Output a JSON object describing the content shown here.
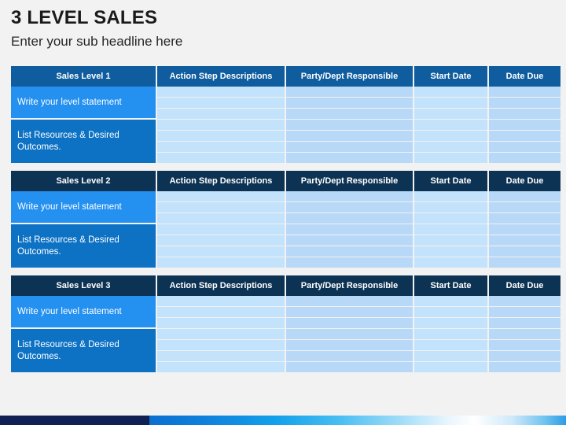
{
  "slide": {
    "title": "3 LEVEL SALES",
    "subtitle": "Enter your sub headline here",
    "background_color": "#f2f2f2"
  },
  "colors": {
    "header_medium_blue": "#0f5d9e",
    "header_dark_navy": "#0d3354",
    "statement_bright_blue": "#2490f0",
    "statement_deep_blue": "#0d72c4",
    "cell_light_blue": "#c3e2fb",
    "cell_mid_blue": "#b8d8f8",
    "bar_navy": "#101f54",
    "bar_gradient_start": "#0b6fd0",
    "bar_gradient_end": "#2d9ce4"
  },
  "columns": [
    "Action Step Descriptions",
    "Party/Dept Responsible",
    "Start Date",
    "Date Due"
  ],
  "tables": [
    {
      "level_header": "Sales Level 1",
      "header_style": "medium",
      "statement": "Write your level statement",
      "resources": "List Resources & Desired Outcomes.",
      "empty_rows": 7,
      "statement_rowspan": 3,
      "resources_rowspan": 4
    },
    {
      "level_header": "Sales Level 2",
      "header_style": "dark",
      "statement": "Write your level statement",
      "resources": "List Resources & Desired Outcomes.",
      "empty_rows": 7,
      "statement_rowspan": 3,
      "resources_rowspan": 4
    },
    {
      "level_header": "Sales Level 3",
      "header_style": "dark",
      "statement": "Write your level statement",
      "resources": "List Resources & Desired Outcomes.",
      "empty_rows": 7,
      "statement_rowspan": 3,
      "resources_rowspan": 4
    }
  ]
}
